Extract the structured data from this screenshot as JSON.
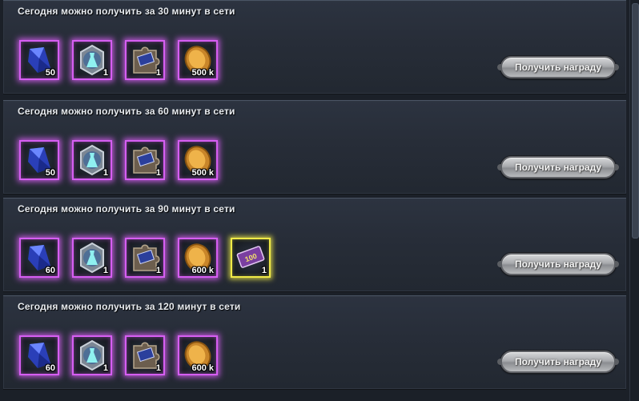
{
  "rewards": [
    {
      "title": "Сегодня можно получить за 30 минут в сети",
      "items": [
        {
          "icon": "blue-crystal-icon",
          "count": "50"
        },
        {
          "icon": "dress-medal-icon",
          "count": "1"
        },
        {
          "icon": "puzzle-piece-icon",
          "count": "1"
        },
        {
          "icon": "gold-coin-icon",
          "count": "500 k"
        }
      ],
      "button": "Получить награду"
    },
    {
      "title": "Сегодня можно получить за 60 минут в сети",
      "items": [
        {
          "icon": "blue-crystal-icon",
          "count": "50"
        },
        {
          "icon": "dress-medal-icon",
          "count": "1"
        },
        {
          "icon": "puzzle-piece-icon",
          "count": "1"
        },
        {
          "icon": "gold-coin-icon",
          "count": "500 k"
        }
      ],
      "button": "Получить награду"
    },
    {
      "title": "Сегодня можно получить за 90 минут в сети",
      "items": [
        {
          "icon": "blue-crystal-icon",
          "count": "60"
        },
        {
          "icon": "dress-medal-icon",
          "count": "1"
        },
        {
          "icon": "puzzle-piece-icon",
          "count": "1"
        },
        {
          "icon": "gold-coin-icon",
          "count": "600 k"
        },
        {
          "icon": "ticket-100-icon",
          "count": "1",
          "ticket_text": "100"
        }
      ],
      "button": "Получить награду"
    },
    {
      "title": "Сегодня можно получить за 120 минут в сети",
      "items": [
        {
          "icon": "blue-crystal-icon",
          "count": "60"
        },
        {
          "icon": "dress-medal-icon",
          "count": "1"
        },
        {
          "icon": "puzzle-piece-icon",
          "count": "1"
        },
        {
          "icon": "gold-coin-icon",
          "count": "600 k"
        }
      ],
      "button": "Получить награду"
    }
  ],
  "colors": {
    "slot_border": "#d65ef2",
    "rare_slot_border": "#f0ea47",
    "panel_bg": "#272d38",
    "button": "#a9abae"
  }
}
